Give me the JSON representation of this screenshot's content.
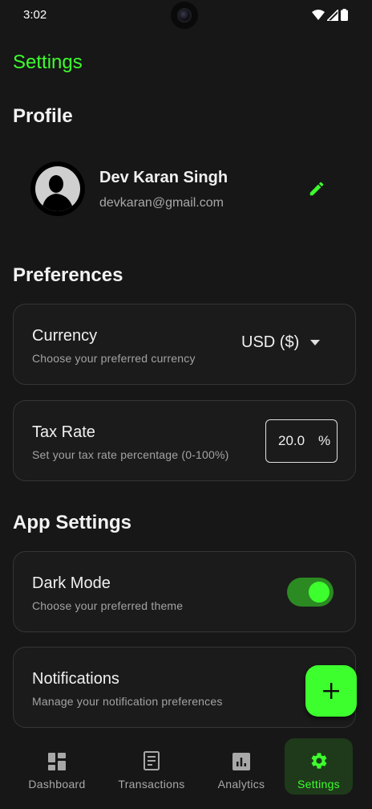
{
  "status_bar": {
    "time": "3:02"
  },
  "page_title": "Settings",
  "profile": {
    "section_title": "Profile",
    "name": "Dev Karan Singh",
    "email": "devkaran@gmail.com"
  },
  "preferences": {
    "section_title": "Preferences",
    "currency": {
      "title": "Currency",
      "subtitle": "Choose your preferred currency",
      "selected": "USD ($)"
    },
    "tax_rate": {
      "title": "Tax Rate",
      "subtitle": "Set your tax rate percentage (0-100%)",
      "value": "20.0",
      "suffix": "%"
    }
  },
  "app_settings": {
    "section_title": "App Settings",
    "dark_mode": {
      "title": "Dark Mode",
      "subtitle": "Choose your preferred theme",
      "enabled": true
    },
    "notifications": {
      "title": "Notifications",
      "subtitle": "Manage your notification preferences"
    }
  },
  "fab": {
    "icon": "plus-icon"
  },
  "bottom_nav": {
    "items": [
      {
        "label": "Dashboard",
        "icon": "dashboard-icon",
        "active": false
      },
      {
        "label": "Transactions",
        "icon": "receipt-icon",
        "active": false
      },
      {
        "label": "Analytics",
        "icon": "analytics-icon",
        "active": false
      },
      {
        "label": "Settings",
        "icon": "gear-icon",
        "active": true
      }
    ]
  },
  "colors": {
    "accent": "#3dff2e",
    "background": "#171717",
    "card": "#1b1b1b",
    "muted_text": "#a8a8a8"
  }
}
